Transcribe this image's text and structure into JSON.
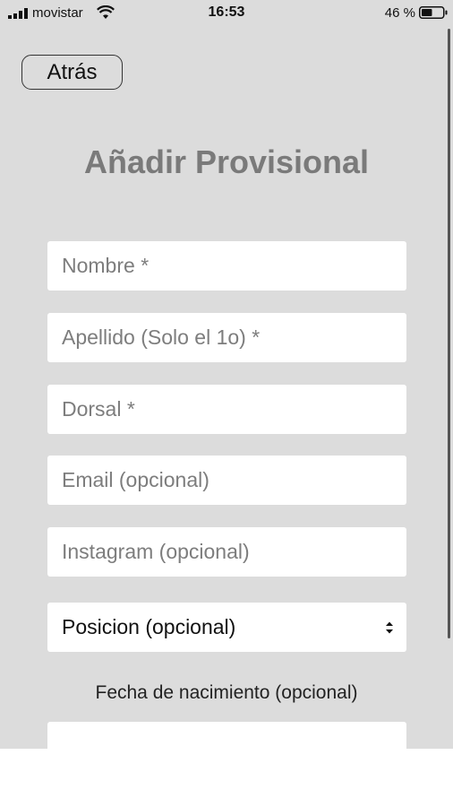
{
  "status_bar": {
    "carrier": "movistar",
    "time": "16:53",
    "battery": "46 %"
  },
  "back_button": {
    "label": "Atrás"
  },
  "page": {
    "title": "Añadir Provisional"
  },
  "form": {
    "nombre_placeholder": "Nombre *",
    "apellido_placeholder": "Apellido (Solo el 1o) *",
    "dorsal_placeholder": "Dorsal *",
    "email_placeholder": "Email (opcional)",
    "instagram_placeholder": "Instagram (opcional)",
    "posicion_value": "Posicion (opcional)",
    "fecha_label": "Fecha de nacimiento (opcional)"
  },
  "icons": {
    "signal": "signal-bars-icon",
    "wifi": "wifi-icon",
    "battery": "battery-icon",
    "select_arrows": "up-down-arrows-icon"
  }
}
